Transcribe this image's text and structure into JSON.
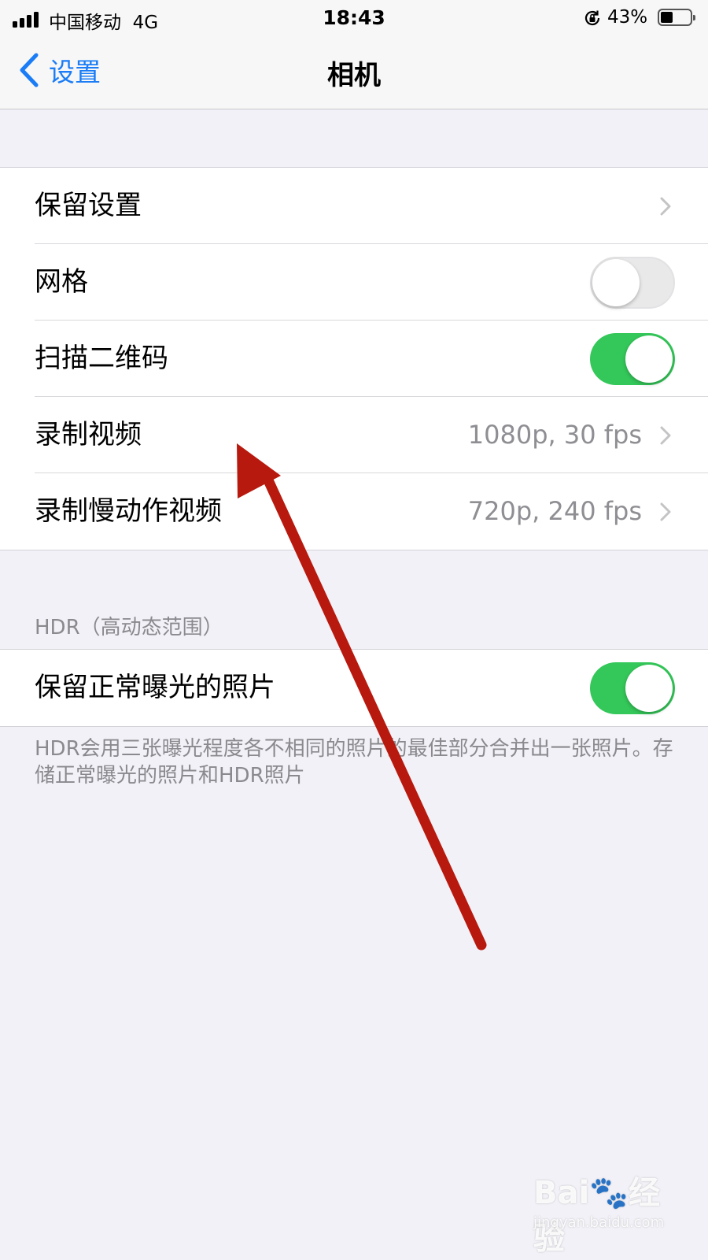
{
  "status_bar": {
    "carrier": "中国移动",
    "network": "4G",
    "time": "18:43",
    "battery_percent": "43%",
    "battery_level": 0.43,
    "signal_bars": 4,
    "icons": [
      "signal-icon",
      "orientation-lock-icon",
      "battery-icon"
    ]
  },
  "nav": {
    "back_label": "设置",
    "title": "相机",
    "back_icon": "chevron-left-icon"
  },
  "groups": {
    "camera": {
      "rows": [
        {
          "label": "保留设置",
          "type": "link"
        },
        {
          "label": "网格",
          "type": "toggle",
          "on": false
        },
        {
          "label": "扫描二维码",
          "type": "toggle",
          "on": true
        },
        {
          "label": "录制视频",
          "value": "1080p, 30 fps",
          "type": "link"
        },
        {
          "label": "录制慢动作视频",
          "value": "720p, 240 fps",
          "type": "link"
        }
      ]
    },
    "hdr": {
      "header": "HDR（高动态范围）",
      "rows": [
        {
          "label": "保留正常曝光的照片",
          "type": "toggle",
          "on": true
        }
      ],
      "footer": "HDR会用三张曝光程度各不相同的照片的最佳部分合并出一张照片。存储正常曝光的照片和HDR照片"
    }
  },
  "watermark": {
    "logo": "Bai🐾经验",
    "url": "jingyan.baidu.com"
  },
  "colors": {
    "accent": "#1a7cf6",
    "toggle_on": "#34c759",
    "annotation_arrow": "#c0180c",
    "background": "#f2f1f7"
  }
}
